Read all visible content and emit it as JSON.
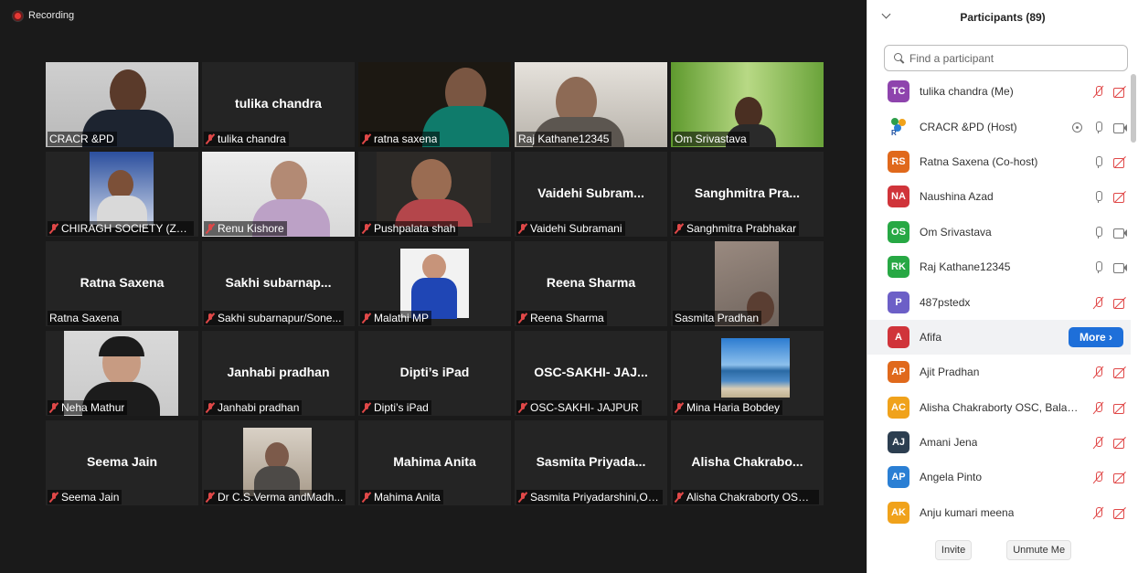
{
  "recording": {
    "label": "Recording"
  },
  "tiles": [
    {
      "label": "CRACR &PD",
      "name": "",
      "muted": false,
      "active": true,
      "video": "man-glasses"
    },
    {
      "label": "tulika chandra",
      "name": "tulika chandra",
      "muted": true
    },
    {
      "label": "ratna saxena",
      "name": "",
      "muted": true,
      "video": "woman-green"
    },
    {
      "label": "Raj Kathane12345",
      "name": "",
      "muted": false,
      "video": "man-grey"
    },
    {
      "label": "Om Srivastava",
      "name": "",
      "muted": false,
      "video": "man-grass"
    },
    {
      "label": "CHIRAGH SOCIETY (Zafa...",
      "name": "",
      "muted": true,
      "video": "man-curtain"
    },
    {
      "label": "Renu Kishore",
      "name": "",
      "muted": true,
      "video": "woman-light"
    },
    {
      "label": "Pushpalata shah",
      "name": "",
      "muted": true,
      "video": "woman-dark"
    },
    {
      "label": "Vaidehi Subramani",
      "name": "Vaidehi  Subram...",
      "muted": true
    },
    {
      "label": "Sanghmitra Prabhakar",
      "name": "Sanghmitra  Pra...",
      "muted": true
    },
    {
      "label": "Ratna Saxena",
      "name": "Ratna Saxena",
      "muted": false
    },
    {
      "label": "Sakhi subarnapur/Sone...",
      "name": "Sakhi  subarnap...",
      "muted": true
    },
    {
      "label": "Malathi MP",
      "name": "",
      "muted": true,
      "video": "woman-blue"
    },
    {
      "label": "Reena Sharma",
      "name": "Reena Sharma",
      "muted": true
    },
    {
      "label": "Sasmita Pradhan",
      "name": "",
      "muted": false,
      "video": "selfie"
    },
    {
      "label": "Neha Mathur",
      "name": "",
      "muted": true,
      "video": "girl-glasses"
    },
    {
      "label": "Janhabi pradhan",
      "name": "Janhabi pradhan",
      "muted": true
    },
    {
      "label": "Dipti’s iPad",
      "name": "Dipti’s iPad",
      "muted": true
    },
    {
      "label": "OSC-SAKHI- JAJPUR",
      "name": "OSC-SAKHI-  JAJ...",
      "muted": true
    },
    {
      "label": "Mina Haria Bobdey",
      "name": "",
      "muted": true,
      "video": "sea"
    },
    {
      "label": "Seema Jain",
      "name": "Seema Jain",
      "muted": true
    },
    {
      "label": "Dr C.S.Verma andMadh...",
      "name": "",
      "muted": true,
      "video": "man-old"
    },
    {
      "label": "Mahima Anita",
      "name": "Mahima Anita",
      "muted": true
    },
    {
      "label": "Sasmita Priyadarshini,Os...",
      "name": "Sasmita  Priyada...",
      "muted": true
    },
    {
      "label": "Alisha Chakraborty OSC,...",
      "name": "Alisha  Chakrabo...",
      "muted": true
    }
  ],
  "panel": {
    "title": "Participants (89)",
    "search_placeholder": "Find a participant",
    "more_label": "More ›",
    "invite_label": "Invite",
    "unmute_label": "Unmute Me",
    "participants": [
      {
        "initials": "TC",
        "name": "tulika chandra (Me)",
        "color": "#8e44ad",
        "mic": "muted",
        "cam": "muted"
      },
      {
        "initials": "",
        "name": "CRACR &PD (Host)",
        "color": "#ffffff",
        "mic": "on",
        "cam": "on",
        "share": true,
        "logo": true
      },
      {
        "initials": "RS",
        "name": "Ratna Saxena (Co-host)",
        "color": "#e0691c",
        "mic": "on",
        "cam": "muted"
      },
      {
        "initials": "NA",
        "name": "Naushina Azad",
        "color": "#d0343a",
        "mic": "on",
        "cam": "muted"
      },
      {
        "initials": "OS",
        "name": "Om Srivastava",
        "color": "#27a844",
        "mic": "on",
        "cam": "on"
      },
      {
        "initials": "RK",
        "name": "Raj Kathane12345",
        "color": "#27a844",
        "mic": "on",
        "cam": "on"
      },
      {
        "initials": "P",
        "name": "487pstedx",
        "color": "#6c5fc7",
        "mic": "muted",
        "cam": "muted"
      },
      {
        "initials": "A",
        "name": "Afifa",
        "color": "#d0343a",
        "mic": "none",
        "cam": "none",
        "hover": true
      },
      {
        "initials": "AP",
        "name": "Ajit Pradhan",
        "color": "#e0691c",
        "mic": "muted",
        "cam": "muted"
      },
      {
        "initials": "AC",
        "name": "Alisha Chakraborty OSC, Balan...",
        "color": "#f0a21b",
        "mic": "muted",
        "cam": "muted"
      },
      {
        "initials": "AJ",
        "name": "Amani Jena",
        "color": "#2c3e50",
        "mic": "muted",
        "cam": "muted"
      },
      {
        "initials": "AP",
        "name": "Angela Pinto",
        "color": "#2a7fd4",
        "mic": "muted",
        "cam": "muted"
      },
      {
        "initials": "AK",
        "name": "Anju kumari meena",
        "color": "#f0a21b",
        "mic": "muted",
        "cam": "muted"
      }
    ]
  }
}
